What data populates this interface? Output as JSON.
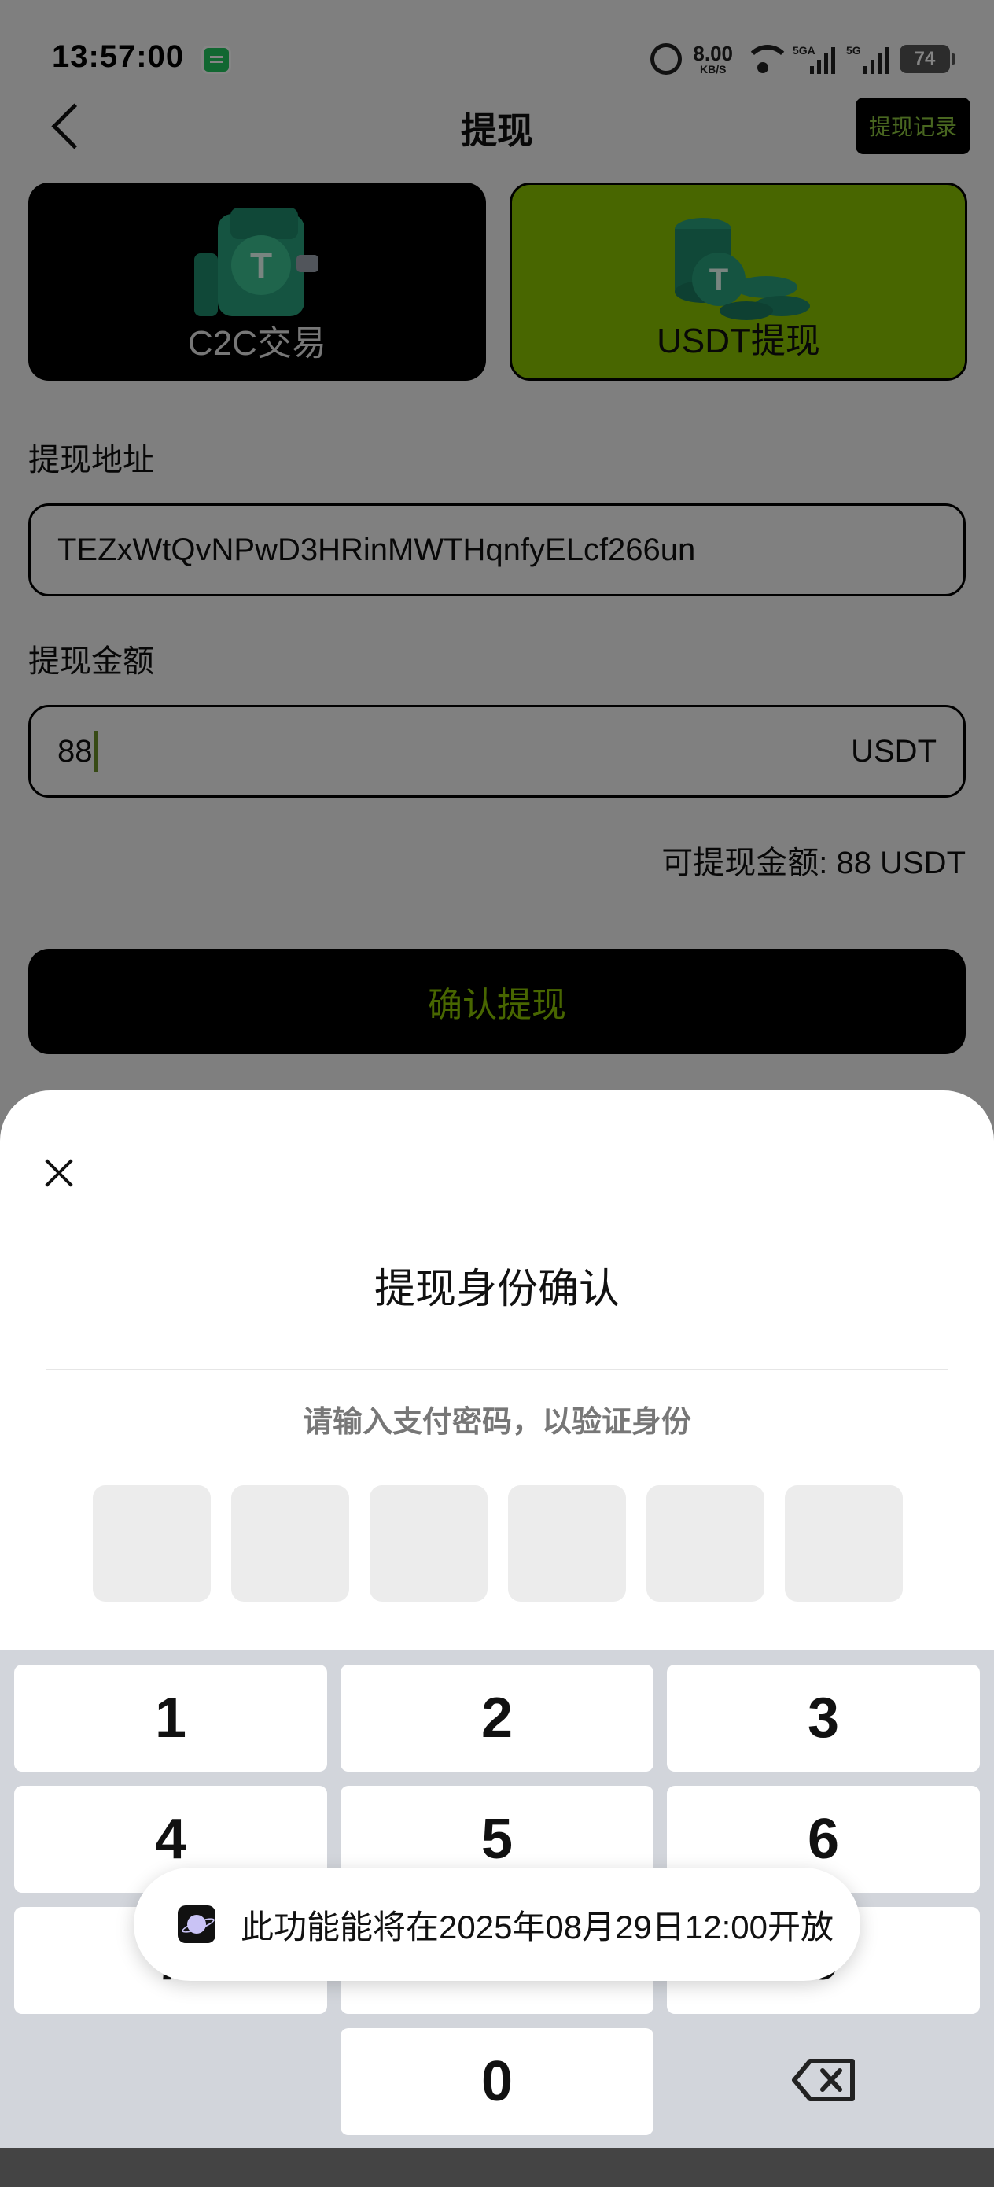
{
  "status_bar": {
    "time": "13:57:00",
    "net_speed_value": "8.00",
    "net_speed_unit": "KB/S",
    "signal1_label": "5GA",
    "signal2_label": "5G",
    "battery": "74"
  },
  "header": {
    "title": "提现",
    "history_label": "提现记录"
  },
  "tabs": [
    {
      "label": "C2C交易",
      "selected": false
    },
    {
      "label": "USDT提现",
      "selected": true
    }
  ],
  "form": {
    "address_label": "提现地址",
    "address_value": "TEZxWtQvNPwD3HRinMWTHqnfyELcf266un",
    "amount_label": "提现金额",
    "amount_value": "88",
    "amount_unit": "USDT",
    "available_text": "可提现金额: 88 USDT",
    "confirm_label": "确认提现"
  },
  "dialog": {
    "title": "提现身份确认",
    "hint": "请输入支付密码，以验证身份"
  },
  "keypad": {
    "keys": [
      "1",
      "2",
      "3",
      "4",
      "5",
      "6",
      "7",
      "8",
      "9",
      "0"
    ]
  },
  "toast": {
    "text": "此功能能将在2025年08月29日12:00开放"
  },
  "colors": {
    "accent_green": "#8bc400",
    "dark": "#000000",
    "overlay": "rgba(0,0,0,0.48)"
  }
}
